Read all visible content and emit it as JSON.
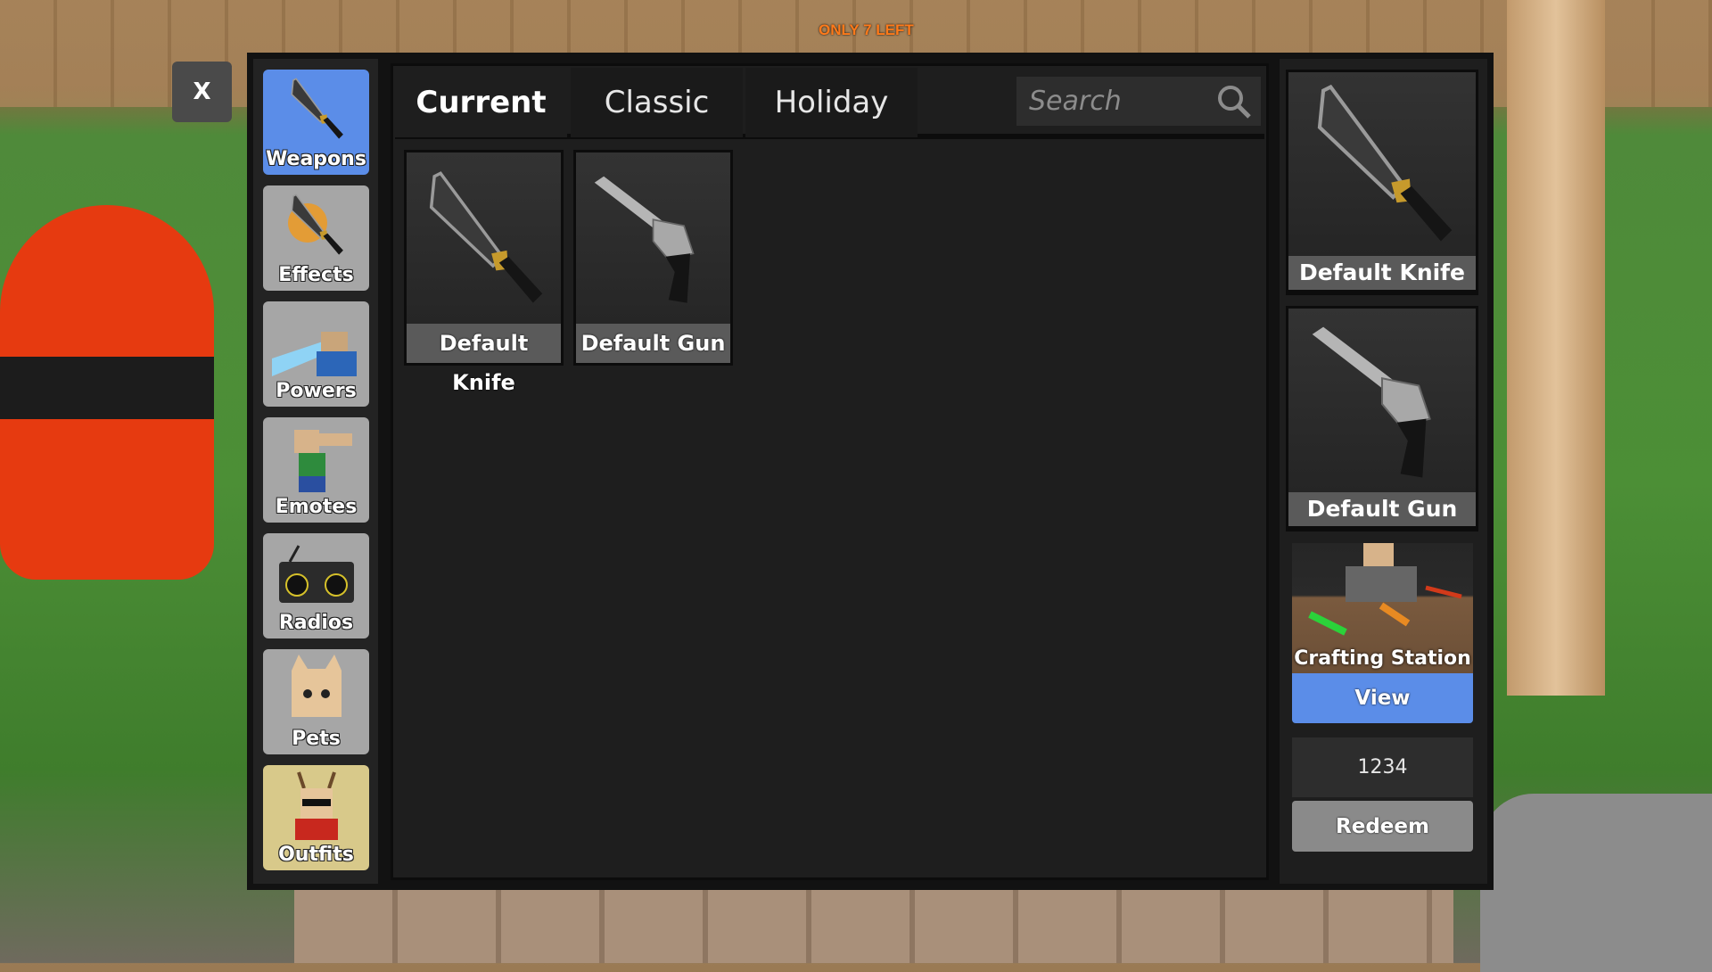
{
  "background": {
    "banner": "ONLY 7 LEFT"
  },
  "close_label": "X",
  "sidebar": {
    "items": [
      {
        "label": "Weapons",
        "icon": "knife-icon",
        "active": true
      },
      {
        "label": "Effects",
        "icon": "flaming-knife-icon"
      },
      {
        "label": "Powers",
        "icon": "powers-icon"
      },
      {
        "label": "Emotes",
        "icon": "emote-icon"
      },
      {
        "label": "Radios",
        "icon": "radio-icon"
      },
      {
        "label": "Pets",
        "icon": "pet-icon"
      },
      {
        "label": "Outfits",
        "icon": "outfit-icon"
      }
    ]
  },
  "tabs": [
    {
      "label": "Current",
      "active": true
    },
    {
      "label": "Classic"
    },
    {
      "label": "Holiday"
    }
  ],
  "search": {
    "placeholder": "Search",
    "value": ""
  },
  "items": [
    {
      "name": "Default Knife",
      "icon": "knife-icon"
    },
    {
      "name": "Default Gun",
      "icon": "revolver-icon"
    }
  ],
  "equipped": [
    {
      "name": "Default Knife",
      "icon": "knife-icon"
    },
    {
      "name": "Default Gun",
      "icon": "revolver-icon"
    }
  ],
  "crafting": {
    "title": "Crafting Station",
    "view_label": "View"
  },
  "code": {
    "value": "1234",
    "redeem_label": "Redeem"
  },
  "colors": {
    "accent": "#5b8de8",
    "panel": "#1e1e1e",
    "button_gray": "#a6a6a6"
  }
}
